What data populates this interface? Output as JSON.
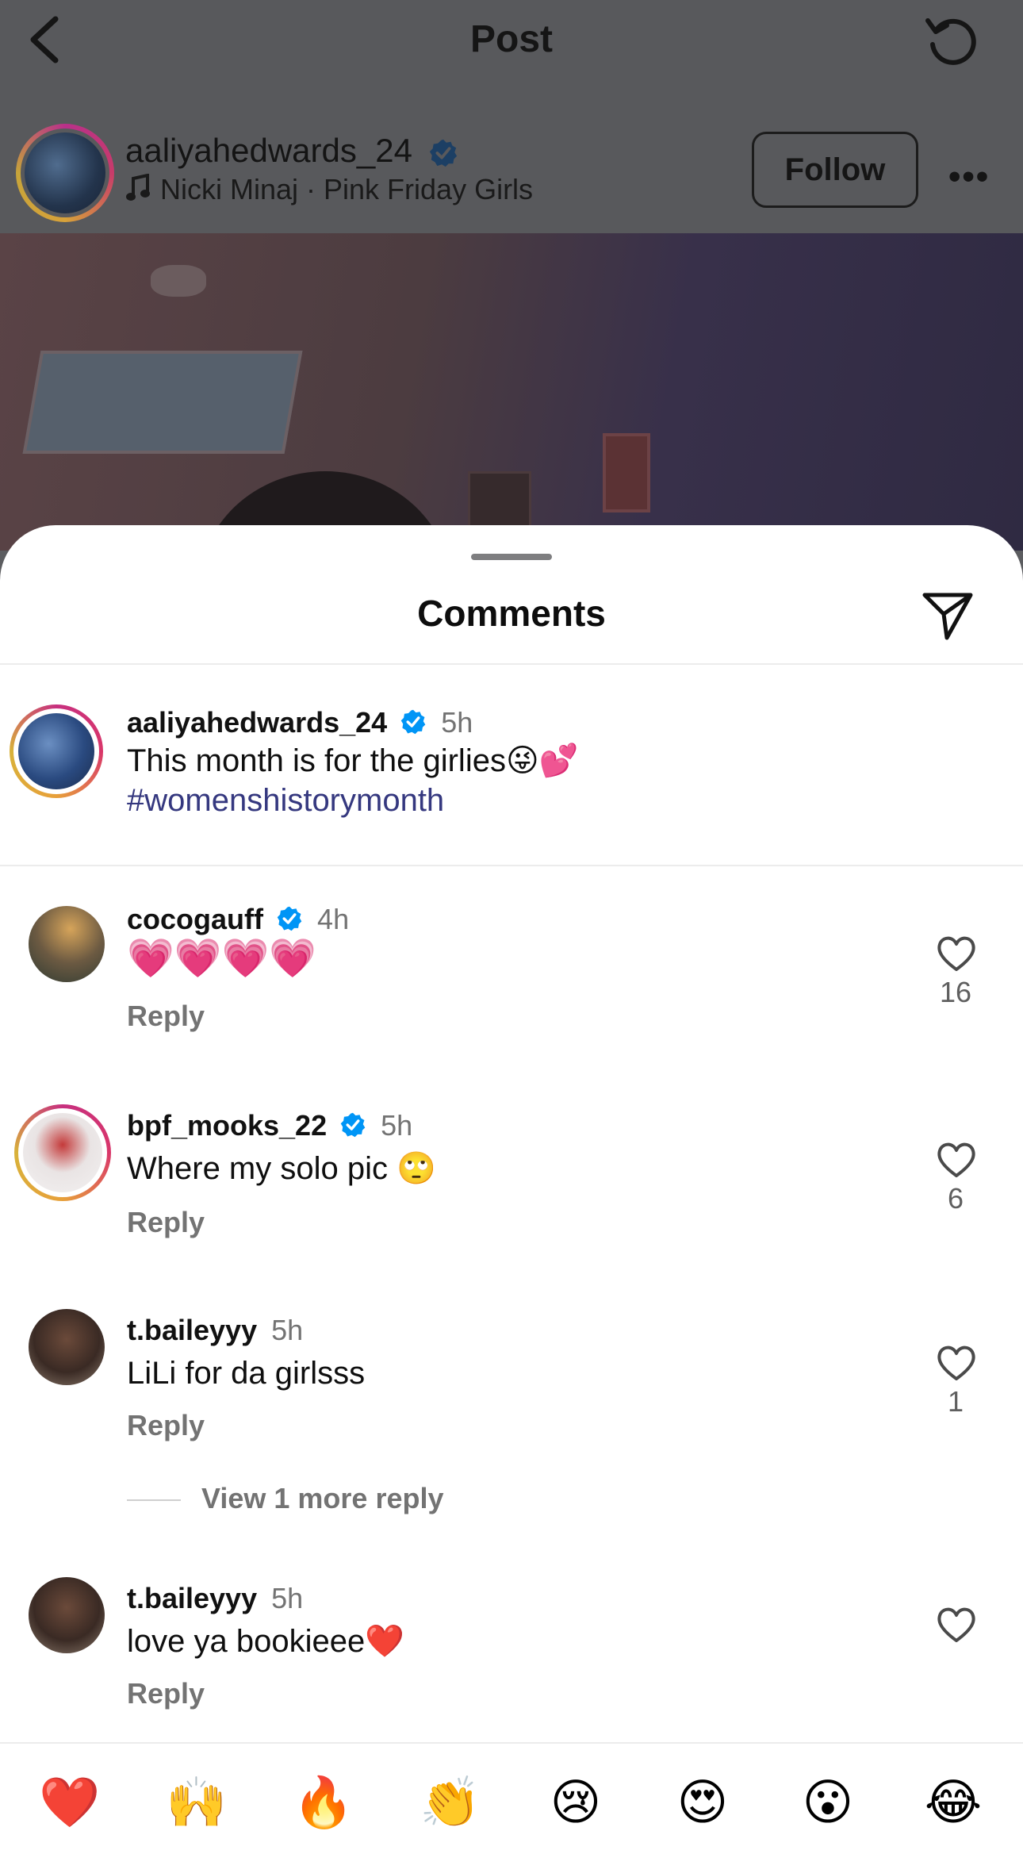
{
  "topbar": {
    "title": "Post"
  },
  "post_header": {
    "username": "aaliyahedwards_24",
    "audio": "Nicki Minaj · Pink Friday Girls",
    "follow_label": "Follow",
    "more_label": "•••"
  },
  "sheet": {
    "title": "Comments"
  },
  "caption": {
    "username": "aaliyahedwards_24",
    "time": "5h",
    "text": "This month is for the girlies😜💕",
    "hashtag": "#womenshistorymonth"
  },
  "comments": [
    {
      "username": "cocogauff",
      "verified": true,
      "time": "4h",
      "text": "💗💗💗💗",
      "reply_label": "Reply",
      "likes": "16"
    },
    {
      "username": "bpf_mooks_22",
      "verified": true,
      "time": "5h",
      "text": "Where my solo pic 🙄",
      "reply_label": "Reply",
      "likes": "6"
    },
    {
      "username": "t.baileyyy",
      "verified": false,
      "time": "5h",
      "text": "LiLi for da girlsss",
      "reply_label": "Reply",
      "likes": "1"
    },
    {
      "username": "t.baileyyy",
      "verified": false,
      "time": "5h",
      "text": "love ya bookieee❤️",
      "reply_label": "Reply",
      "likes": ""
    }
  ],
  "view_more_replies": "View 1 more reply",
  "quick_reactions": [
    "❤️",
    "🙌",
    "🔥",
    "👏",
    "😢",
    "😍",
    "😮",
    "😂"
  ],
  "colors": {
    "verified_blue": "#0095f6",
    "hashtag": "#35387f",
    "dim_overlay": "#58595c"
  }
}
